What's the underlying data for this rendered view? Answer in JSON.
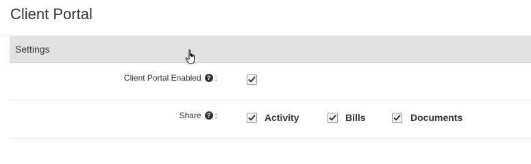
{
  "page": {
    "title": "Client Portal"
  },
  "section": {
    "title": "Settings"
  },
  "rows": {
    "enabled": {
      "label": "Client Portal Enabled",
      "help_icon": "question-circle-icon",
      "colon": ":",
      "checked": true
    },
    "share": {
      "label": "Share",
      "help_icon": "question-circle-icon",
      "colon": ":",
      "options": [
        {
          "label": "Activity",
          "checked": true
        },
        {
          "label": "Bills",
          "checked": true
        },
        {
          "label": "Documents",
          "checked": true
        }
      ]
    }
  },
  "icons": {
    "help": "?",
    "cursor": "hand-pointer-icon",
    "check": "checkmark-icon"
  },
  "colors": {
    "section_header_bg": "#e2e2e2",
    "text": "#333333"
  }
}
